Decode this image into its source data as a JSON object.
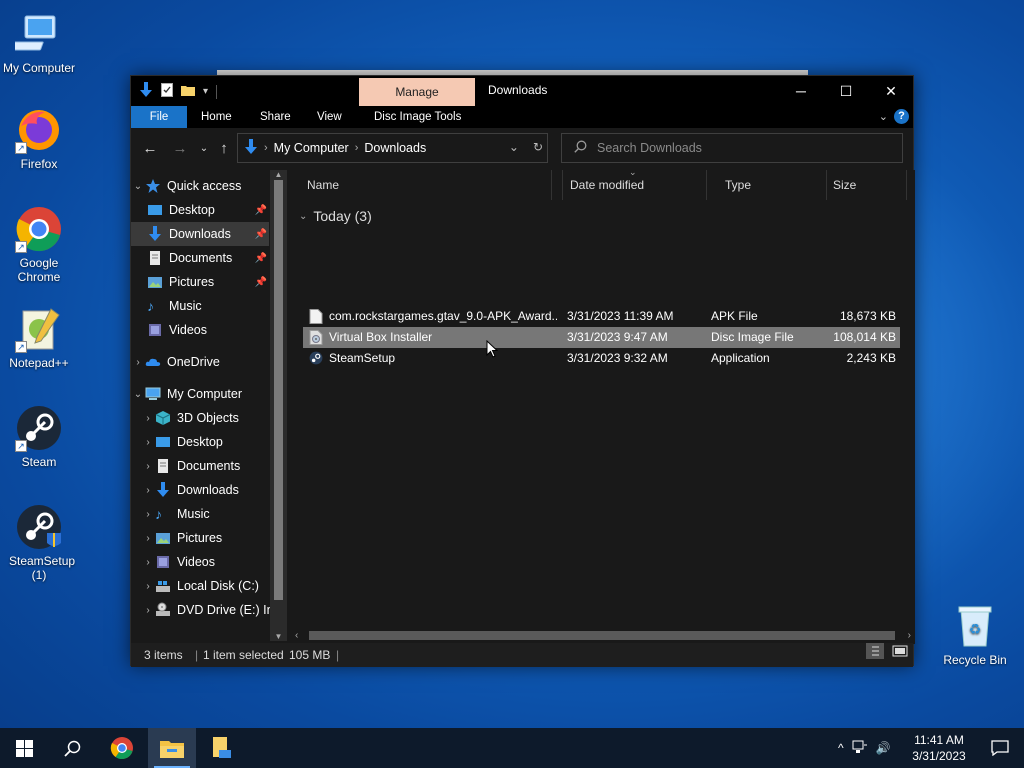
{
  "desktop": {
    "icons": [
      {
        "label": "My Computer"
      },
      {
        "label": "Firefox"
      },
      {
        "label": "Google Chrome"
      },
      {
        "label": "Notepad++"
      },
      {
        "label": "Steam"
      },
      {
        "label": "SteamSetup (1)"
      },
      {
        "label": "Recycle Bin"
      }
    ]
  },
  "window": {
    "title": "Downloads",
    "context_tab": "Manage",
    "ribbon_tabs": [
      "File",
      "Home",
      "Share",
      "View",
      "Disc Image Tools"
    ],
    "address": {
      "parts": [
        "My Computer",
        "Downloads"
      ]
    },
    "search_placeholder": "Search Downloads",
    "nav": {
      "quick_access": "Quick access",
      "quick_items": [
        "Desktop",
        "Downloads",
        "Documents",
        "Pictures",
        "Music",
        "Videos"
      ],
      "onedrive": "OneDrive",
      "my_computer": "My Computer",
      "pc_items": [
        "3D Objects",
        "Desktop",
        "Documents",
        "Downloads",
        "Music",
        "Pictures",
        "Videos",
        "Local Disk (C:)",
        "DVD Drive (E:) In"
      ]
    },
    "columns": {
      "name": "Name",
      "date": "Date modified",
      "type": "Type",
      "size": "Size"
    },
    "group_label": "Today (3)",
    "files": [
      {
        "name": "com.rockstargames.gtav_9.0-APK_Award...",
        "date": "3/31/2023 11:39 AM",
        "type": "APK File",
        "size": "18,673 KB"
      },
      {
        "name": "Virtual Box Installer",
        "date": "3/31/2023 9:47 AM",
        "type": "Disc Image File",
        "size": "108,014 KB"
      },
      {
        "name": "SteamSetup",
        "date": "3/31/2023 9:32 AM",
        "type": "Application",
        "size": "2,243 KB"
      }
    ],
    "status": {
      "items": "3 items",
      "selected": "1 item selected",
      "size": "105 MB"
    }
  },
  "taskbar": {
    "time": "11:41 AM",
    "date": "3/31/2023"
  },
  "colors": {
    "accent": "#1a73c8",
    "manage_tab": "#f5c9b3",
    "selection": "#777777"
  }
}
